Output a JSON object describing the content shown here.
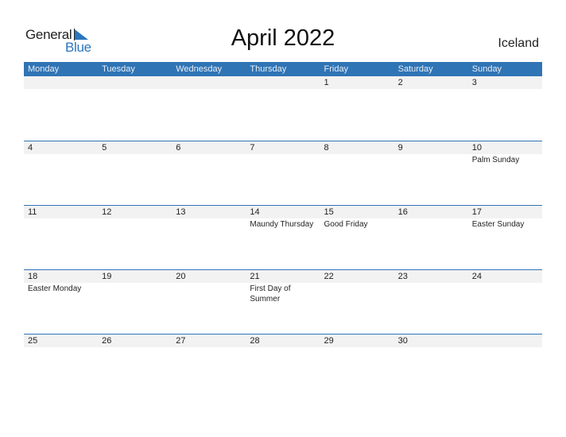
{
  "brand": {
    "word1": "General",
    "word2": "Blue",
    "accent": "#2a76bd"
  },
  "title": "April 2022",
  "country": "Iceland",
  "header_color": "#2f74b5",
  "weekdays": [
    "Monday",
    "Tuesday",
    "Wednesday",
    "Thursday",
    "Friday",
    "Saturday",
    "Sunday"
  ],
  "weeks": [
    {
      "days": [
        "",
        "",
        "",
        "",
        "1",
        "2",
        "3"
      ],
      "events": [
        "",
        "",
        "",
        "",
        "",
        "",
        ""
      ]
    },
    {
      "days": [
        "4",
        "5",
        "6",
        "7",
        "8",
        "9",
        "10"
      ],
      "events": [
        "",
        "",
        "",
        "",
        "",
        "",
        "Palm Sunday"
      ]
    },
    {
      "days": [
        "11",
        "12",
        "13",
        "14",
        "15",
        "16",
        "17"
      ],
      "events": [
        "",
        "",
        "",
        "Maundy Thursday",
        "Good Friday",
        "",
        "Easter Sunday"
      ]
    },
    {
      "days": [
        "18",
        "19",
        "20",
        "21",
        "22",
        "23",
        "24"
      ],
      "events": [
        "Easter Monday",
        "",
        "",
        "First Day of Summer",
        "",
        "",
        ""
      ]
    },
    {
      "days": [
        "25",
        "26",
        "27",
        "28",
        "29",
        "30",
        ""
      ],
      "events": [
        "",
        "",
        "",
        "",
        "",
        "",
        ""
      ]
    }
  ]
}
